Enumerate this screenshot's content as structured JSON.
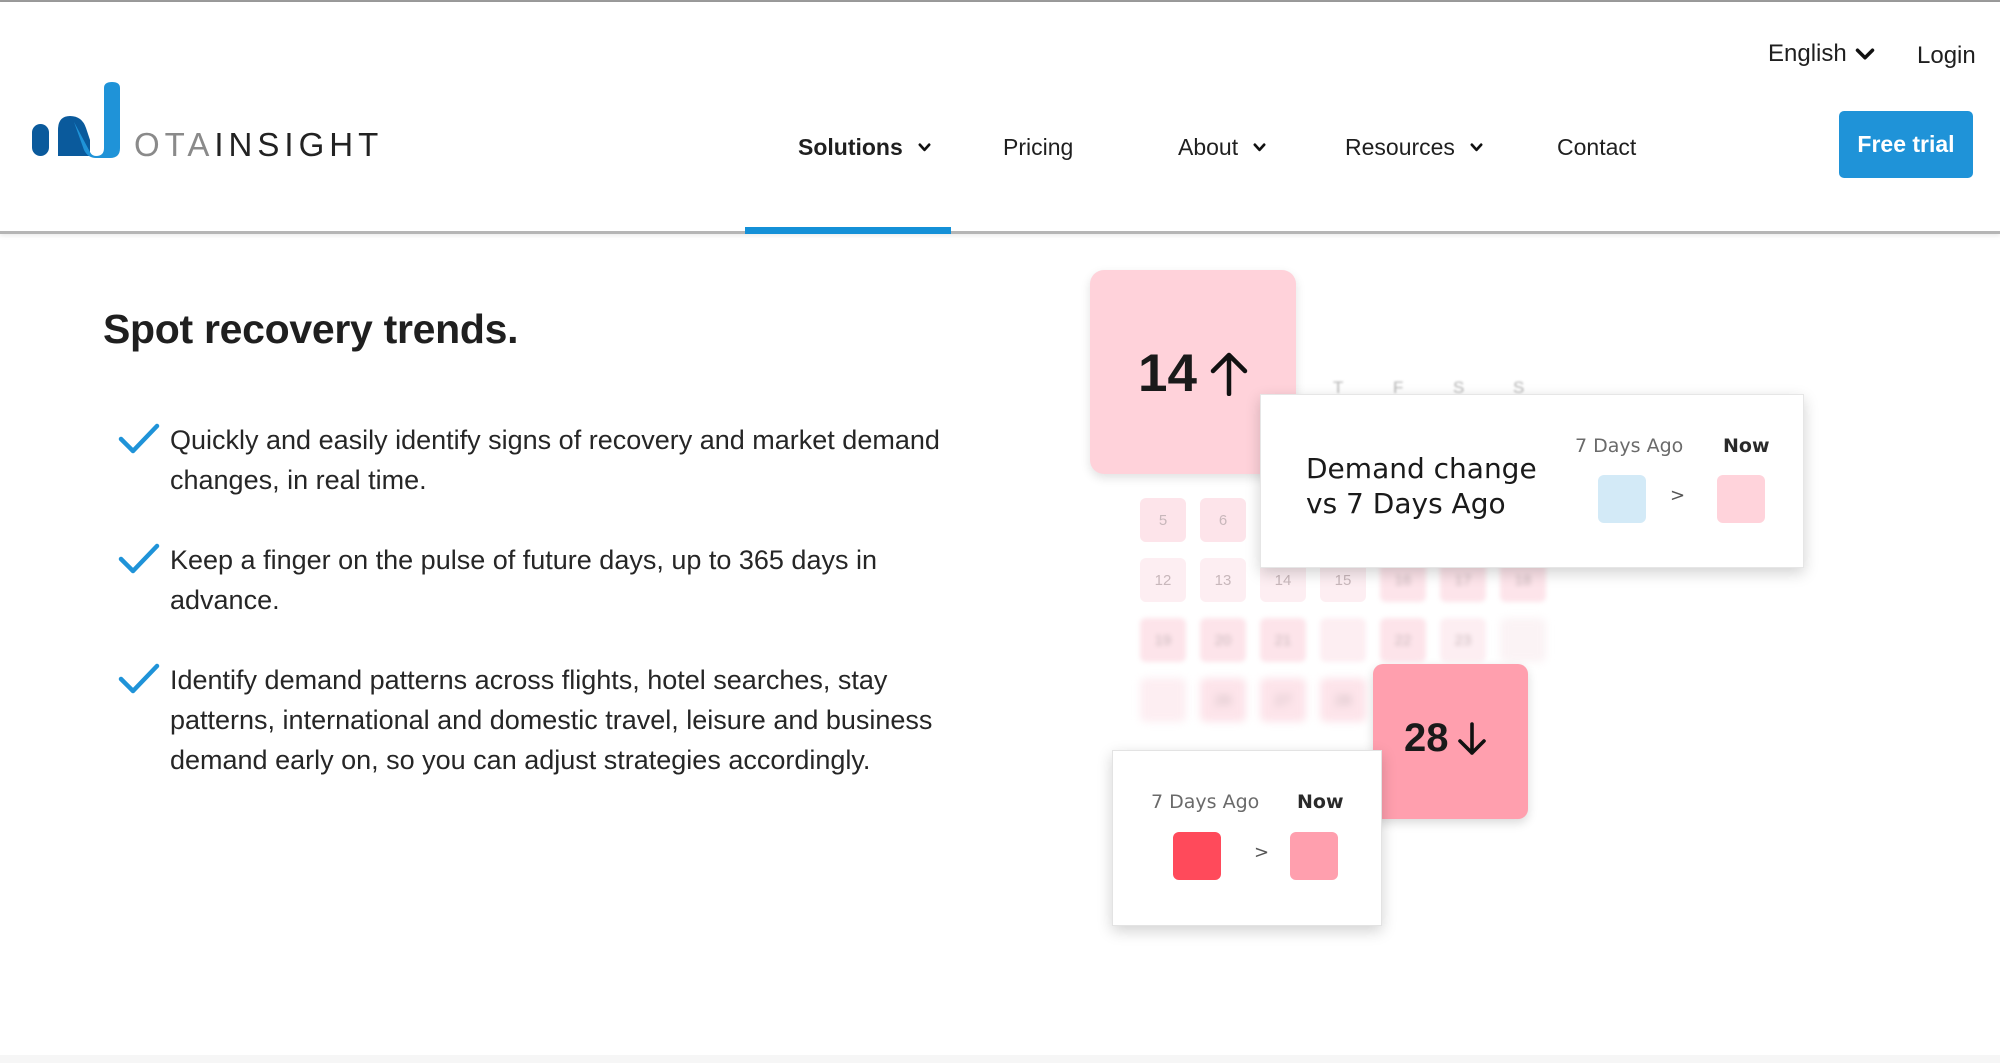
{
  "header": {
    "logo": {
      "part1": "OTA",
      "part2": "INSIGHT",
      "brand_color": "#1f93d8"
    },
    "language": {
      "label": "English",
      "icon": "chevron-down-icon"
    },
    "login_label": "Login",
    "nav": [
      {
        "label": "Solutions",
        "has_dropdown": true,
        "active": true
      },
      {
        "label": "Pricing",
        "has_dropdown": false,
        "active": false
      },
      {
        "label": "About",
        "has_dropdown": true,
        "active": false
      },
      {
        "label": "Resources",
        "has_dropdown": true,
        "active": false
      },
      {
        "label": "Contact",
        "has_dropdown": false,
        "active": false
      }
    ],
    "cta_label": "Free trial",
    "accent_color": "#1490d7"
  },
  "main": {
    "headline": "Spot recovery trends.",
    "bullets": [
      "Quickly and easily identify signs of recovery and market demand changes, in real time.",
      "Keep a finger on the pulse of future days, up to 365 days in advance.",
      "Identify demand patterns across flights, hotel searches, stay patterns, international and domestic travel, leisure and business demand early on, so you can adjust strategies accordingly."
    ],
    "check_icon": "check-icon"
  },
  "illustration": {
    "weekday_headers": [
      "T",
      "F",
      "S",
      "S"
    ],
    "tile_up": {
      "value": "14",
      "icon": "arrow-up-icon"
    },
    "tile_down": {
      "value": "28",
      "icon": "arrow-down-icon"
    },
    "calendar_days": [
      "5",
      "6",
      "12",
      "13",
      "14",
      "15",
      "16",
      "17",
      "18",
      "19",
      "20",
      "21",
      "22",
      "23",
      "26",
      "27",
      "28",
      "29"
    ],
    "demand_card": {
      "title_line1": "Demand change",
      "title_line2": "vs 7 Days Ago",
      "col_ago": "7 Days Ago",
      "col_now": "Now",
      "compare": ">",
      "swatch_ago": "#d3eaf7",
      "swatch_now": "#ffd3db"
    },
    "small_card": {
      "col_ago": "7 Days Ago",
      "col_now": "Now",
      "compare": ">",
      "swatch_ago": "#ff4a5b",
      "swatch_now": "#ff9fae"
    }
  }
}
